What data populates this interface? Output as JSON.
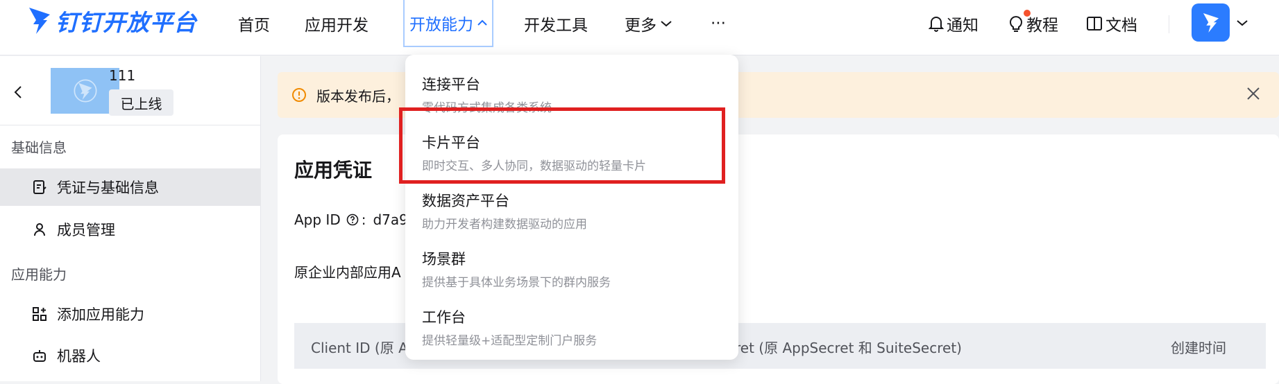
{
  "brand": {
    "name": "钉钉开放平台",
    "color": "#1f6fff"
  },
  "nav": {
    "items": [
      {
        "label": "首页"
      },
      {
        "label": "应用开发"
      },
      {
        "label": "开放能力",
        "active": true
      },
      {
        "label": "开发工具"
      },
      {
        "label": "更多"
      },
      {
        "label": "···"
      }
    ]
  },
  "tools": {
    "notify": "通知",
    "tutorial": "教程",
    "docs": "文档"
  },
  "sidebar": {
    "app_name": "111",
    "app_status": "已上线",
    "groups": [
      {
        "title": "基础信息"
      },
      {
        "title": "应用能力"
      }
    ],
    "items": [
      {
        "label": "凭证与基础信息",
        "active": true,
        "icon": "credential-icon"
      },
      {
        "label": "成员管理",
        "icon": "user-icon"
      },
      {
        "label": "添加应用能力",
        "icon": "apps-add-icon"
      },
      {
        "label": "机器人",
        "icon": "robot-icon"
      }
    ]
  },
  "alert": {
    "text": "版本发布后，"
  },
  "card": {
    "title": "应用凭证",
    "app_id_label": "App ID",
    "app_id_value": "d7a9",
    "legacy_label": "原企业内部应用A",
    "table_headers": [
      "Client ID (原 Ap",
      "ret (原 AppSecret 和 SuiteSecret)",
      "创建时间"
    ]
  },
  "dropdown": {
    "items": [
      {
        "title": "连接平台",
        "desc": "零代码方式集成各类系统"
      },
      {
        "title": "卡片平台",
        "desc": "即时交互、多人协同，数据驱动的轻量卡片",
        "highlighted": true
      },
      {
        "title": "数据资产平台",
        "desc": "助力开发者构建数据驱动的应用"
      },
      {
        "title": "场景群",
        "desc": "提供基于具体业务场景下的群内服务"
      },
      {
        "title": "工作台",
        "desc": "提供轻量级+适配型定制门户服务"
      }
    ]
  }
}
